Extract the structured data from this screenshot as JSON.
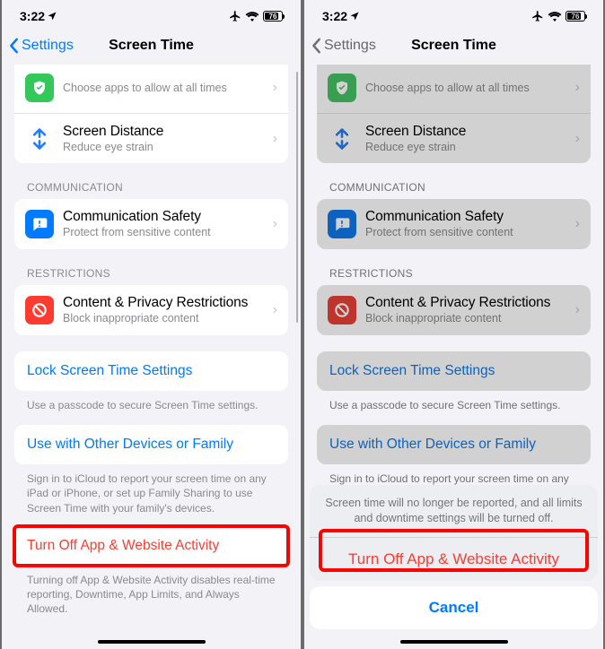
{
  "status": {
    "time": "3:22",
    "battery_pct": "76"
  },
  "nav": {
    "back_label": "Settings",
    "title": "Screen Time"
  },
  "allow_row": {
    "sub": "Choose apps to allow at all times"
  },
  "distance_row": {
    "title": "Screen Distance",
    "sub": "Reduce eye strain"
  },
  "sec_comm": "COMMUNICATION",
  "comm_safety": {
    "title": "Communication Safety",
    "sub": "Protect from sensitive content"
  },
  "sec_restrict": "RESTRICTIONS",
  "restrict_row": {
    "title": "Content & Privacy Restrictions",
    "sub": "Block inappropriate content"
  },
  "lock_link": "Lock Screen Time Settings",
  "lock_note": "Use a passcode to secure Screen Time settings.",
  "share_link": "Use with Other Devices or Family",
  "share_note": "Sign in to iCloud to report your screen time on any iPad or iPhone, or set up Family Sharing to use Screen Time with your family's devices.",
  "turn_off_link": "Turn Off App & Website Activity",
  "turn_off_note": "Turning off App & Website Activity disables real-time reporting, Downtime, App Limits, and Always Allowed.",
  "sheet": {
    "msg": "Screen time will no longer be reported, and all limits and downtime settings will be turned off.",
    "action": "Turn Off App & Website Activity",
    "cancel": "Cancel"
  }
}
